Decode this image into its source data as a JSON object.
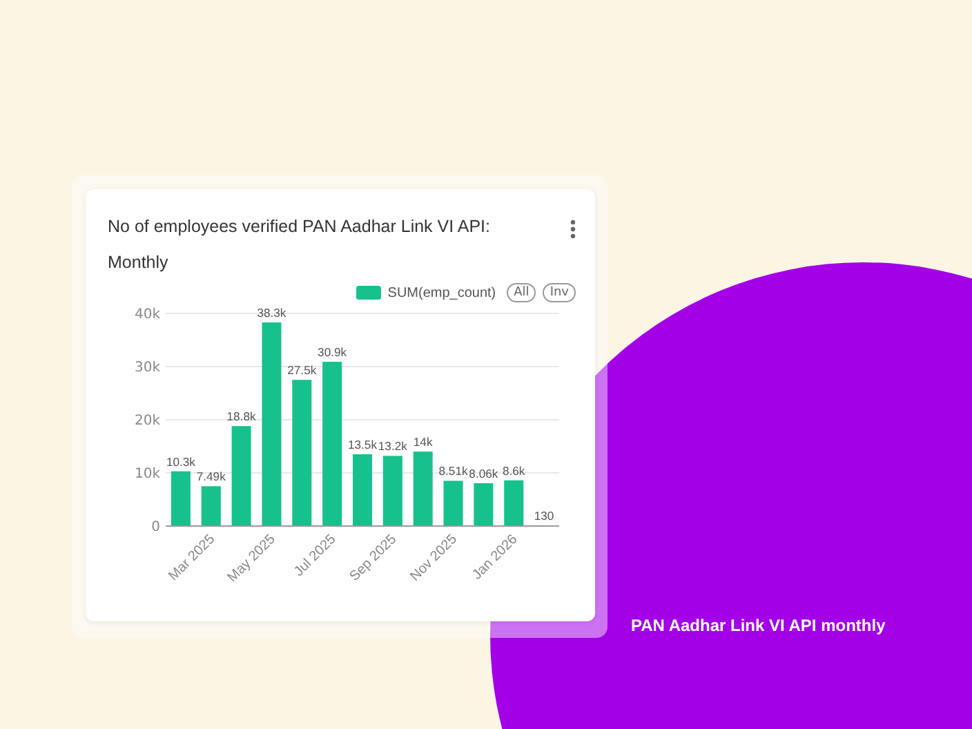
{
  "card": {
    "title": "No of employees verified PAN Aadhar Link VI API: Monthly",
    "legend": {
      "buttons": [
        "All",
        "Inv"
      ]
    },
    "chart_data": {
      "type": "bar",
      "categories": [
        null,
        "Mar 2025",
        null,
        "May 2025",
        null,
        "Jul 2025",
        null,
        "Sep 2025",
        null,
        "Nov 2025",
        null,
        "Jan 2026",
        null
      ],
      "series": [
        {
          "name": "SUM(emp_count)",
          "color": "#16c18d",
          "values": [
            10300,
            7490,
            18800,
            38300,
            27500,
            30900,
            13500,
            13200,
            14000,
            8510,
            8060,
            8600,
            130
          ]
        }
      ],
      "grid": true,
      "value_labels": [
        "10.3k",
        "7.49k",
        "18.8k",
        "38.3k",
        "27.5k",
        "30.9k",
        "13.5k",
        "13.2k",
        "14k",
        "8.51k",
        "8.06k",
        "8.6k",
        "130"
      ],
      "ylim": [
        0,
        40000
      ],
      "yticks": [
        {
          "value": 0,
          "label": "0"
        },
        {
          "value": 10000,
          "label": "10k"
        },
        {
          "value": 20000,
          "label": "20k"
        },
        {
          "value": 30000,
          "label": "30k"
        },
        {
          "value": 40000,
          "label": "40k"
        }
      ]
    }
  },
  "caption": "PAN Aadhar Link VI API monthly"
}
